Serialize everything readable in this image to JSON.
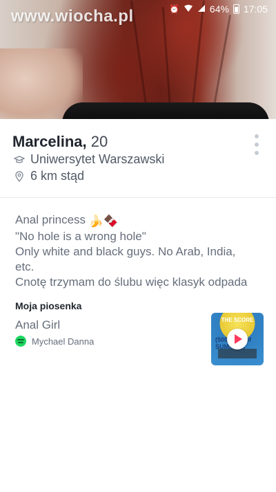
{
  "status": {
    "battery": "64%",
    "time": "17:05"
  },
  "watermark": "www.wiocha.pl",
  "profile": {
    "name": "Marcelina,",
    "age": "20",
    "school": "Uniwersytet Warszawski",
    "distance": "6 km stąd"
  },
  "bio": {
    "line1": "Anal princess",
    "line1_emoji": "🍌🍫",
    "line2": "\"No hole is a wrong hole\"",
    "line3": "Only white and black guys. No Arab, India,",
    "line4": "etc.",
    "line5": "Cnotę trzymam do ślubu więc klasyk odpada"
  },
  "anthem": {
    "heading": "Moja piosenka",
    "song": "Anal Girl",
    "artist": "Mychael Danna",
    "album_text": "THE SCORE",
    "album_big": "(500 days of SUMMER)"
  },
  "colors": {
    "accent": "#fd3a5d",
    "spotify": "#1ed760"
  }
}
